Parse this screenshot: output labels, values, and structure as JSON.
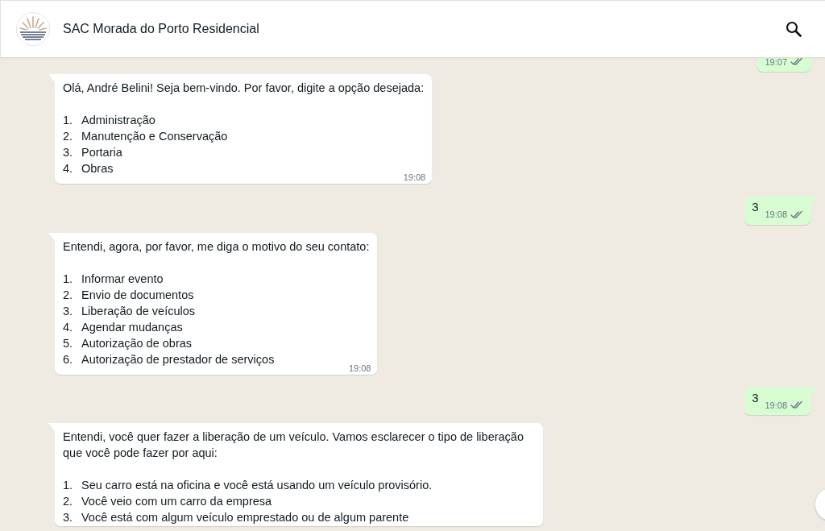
{
  "header": {
    "title": "SAC Morada do Porto Residencial"
  },
  "messages": [
    {
      "kind": "sent",
      "time": "19:07",
      "read": false
    },
    {
      "kind": "received",
      "intro": "Olá, André Belini! Seja bem-vindo. Por favor, digite a opção desejada:",
      "options": [
        {
          "number": "1.",
          "label": "Administração"
        },
        {
          "number": "2.",
          "label": "Manutenção e Conservação"
        },
        {
          "number": "3.",
          "label": "Portaria"
        },
        {
          "number": "4.",
          "label": "Obras"
        }
      ],
      "time": "19:08"
    },
    {
      "kind": "sent",
      "text": "3",
      "time": "19:08",
      "read": false
    },
    {
      "kind": "received",
      "intro": "Entendi, agora, por favor, me diga o motivo do seu contato:",
      "options": [
        {
          "number": "1.",
          "label": "Informar evento"
        },
        {
          "number": "2.",
          "label": "Envio de documentos"
        },
        {
          "number": "3.",
          "label": "Liberação de veículos"
        },
        {
          "number": "4.",
          "label": "Agendar mudanças"
        },
        {
          "number": "5.",
          "label": "Autorização de obras"
        },
        {
          "number": "6.",
          "label": "Autorização de prestador de serviços"
        }
      ],
      "time": "19:08"
    },
    {
      "kind": "sent",
      "text": "3",
      "time": "19:08",
      "read": false
    },
    {
      "kind": "received",
      "intro": "Entendi, você quer fazer a liberação de um veículo. Vamos esclarecer o tipo de liberação que você pode fazer por aqui:",
      "options": [
        {
          "number": "1.",
          "label": "Seu carro está na oficina e você está usando um veículo provisório."
        },
        {
          "number": "2.",
          "label": "Você veio com um carro da empresa"
        },
        {
          "number": "3.",
          "label": "Você está com algum veículo emprestado ou de algum parente"
        }
      ]
    }
  ]
}
